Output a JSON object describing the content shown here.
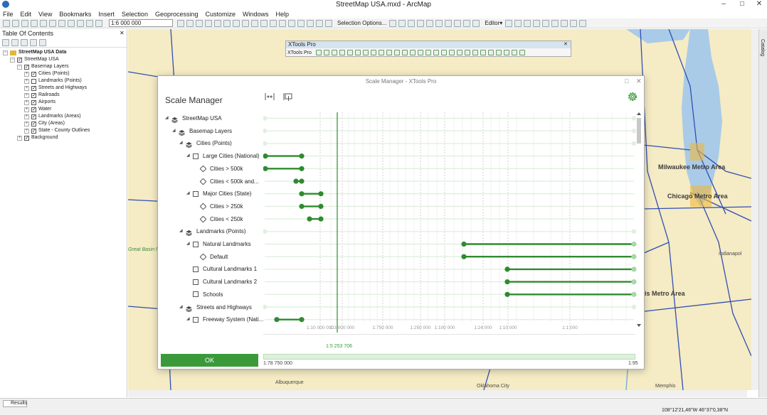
{
  "window": {
    "title": "StreetMap USA.mxd - ArcMap",
    "minimize": "–",
    "maximize": "□",
    "close": "✕"
  },
  "menu": [
    "File",
    "Edit",
    "View",
    "Bookmarks",
    "Insert",
    "Selection",
    "Geoprocessing",
    "Customize",
    "Windows",
    "Help"
  ],
  "toolbar": {
    "scale": "1:6 000 000",
    "selection_options": "Selection Options...",
    "editor": "Editor▾"
  },
  "toc": {
    "title": "Table Of Contents",
    "close": "✕",
    "items": [
      {
        "label": "StreetMap USA Data",
        "checked": null,
        "expanded": true
      },
      {
        "label": "StreetMap USA",
        "checked": true,
        "expanded": true
      },
      {
        "label": "Basemap Layers",
        "checked": true,
        "expanded": true
      },
      {
        "label": "Cities (Points)",
        "checked": true,
        "expanded": false
      },
      {
        "label": "Landmarks (Points)",
        "checked": false,
        "expanded": false
      },
      {
        "label": "Streets and Highways",
        "checked": true,
        "expanded": false
      },
      {
        "label": "Railroads",
        "checked": true,
        "expanded": false
      },
      {
        "label": "Airports",
        "checked": true,
        "expanded": false
      },
      {
        "label": "Water",
        "checked": true,
        "expanded": false
      },
      {
        "label": "Landmarks (Areas)",
        "checked": true,
        "expanded": false
      },
      {
        "label": "City (Areas)",
        "checked": true,
        "expanded": false
      },
      {
        "label": "State - County Outlines",
        "checked": true,
        "expanded": false
      },
      {
        "label": "Background",
        "checked": true,
        "expanded": false
      }
    ]
  },
  "xtools_toolbar": {
    "title": "XTools Pro",
    "row_label": "XTools Pro",
    "close": "✕"
  },
  "map_labels": {
    "milwaukee": "Milwaukee Metro Area",
    "chicago": "Chicago Metro Area",
    "stlouis": "is Metro Area",
    "indianapolis": "Indianapol",
    "albuquerque": "Albuquerque",
    "oklahoma": "Oklahoma City",
    "memphis": "Memphis",
    "great_basin": "Great Basin NP"
  },
  "scale_manager": {
    "window_title": "Scale Manager - XTools Pro",
    "heading": "Scale Manager",
    "ok": "OK",
    "current_scale": "1:5 253 706",
    "range_min": "1:78 750 000",
    "range_max": "1:95",
    "scale_ticks": [
      "1:10 000 000",
      "1:3 000 000",
      "1:750 000",
      "1:250 000",
      "1:100 000",
      "1:24 000",
      "1:10 000",
      "1:1 000"
    ],
    "tree": [
      {
        "label": "StreetMap USA",
        "level": 0,
        "icon": "layers",
        "expanded": true
      },
      {
        "label": "Basemap Layers",
        "level": 1,
        "icon": "layers",
        "expanded": true
      },
      {
        "label": "Cities (Points)",
        "level": 2,
        "icon": "layers",
        "expanded": true
      },
      {
        "label": "Large Cities (National)",
        "level": 3,
        "icon": "box",
        "expanded": true
      },
      {
        "label": "Cities > 500k",
        "level": 4,
        "icon": "tag",
        "expanded": null
      },
      {
        "label": "Cities < 500k and...",
        "level": 4,
        "icon": "tag",
        "expanded": null
      },
      {
        "label": "Major Cities (State)",
        "level": 3,
        "icon": "box",
        "expanded": true
      },
      {
        "label": "Cities > 250k",
        "level": 4,
        "icon": "tag",
        "expanded": null
      },
      {
        "label": "Cities < 250k",
        "level": 4,
        "icon": "tag",
        "expanded": null
      },
      {
        "label": "Landmarks (Points)",
        "level": 2,
        "icon": "layers",
        "expanded": true
      },
      {
        "label": "Natural Landmarks",
        "level": 3,
        "icon": "box",
        "expanded": true
      },
      {
        "label": "Default",
        "level": 4,
        "icon": "tag",
        "expanded": null
      },
      {
        "label": "Cultural Landmarks 1",
        "level": 3,
        "icon": "box",
        "expanded": null
      },
      {
        "label": "Cultural Landmarks 2",
        "level": 3,
        "icon": "box",
        "expanded": null
      },
      {
        "label": "Schools",
        "level": 3,
        "icon": "box",
        "expanded": null
      },
      {
        "label": "Streets and Highways",
        "level": 2,
        "icon": "layers",
        "expanded": true
      },
      {
        "label": "Freeway System (Nati...",
        "level": 3,
        "icon": "box",
        "expanded": true
      }
    ]
  },
  "status": {
    "results_tab": "Results",
    "coordinates": "108°12'21,46\"W  46°37'0,38\"N"
  },
  "colors": {
    "accent_green": "#3a9a3a",
    "bar_green": "#2e8b2e",
    "track_green": "#dff0df",
    "map_background": "#f5ebc4",
    "water": "#a9cbe8",
    "road": "#2f4fb5"
  }
}
